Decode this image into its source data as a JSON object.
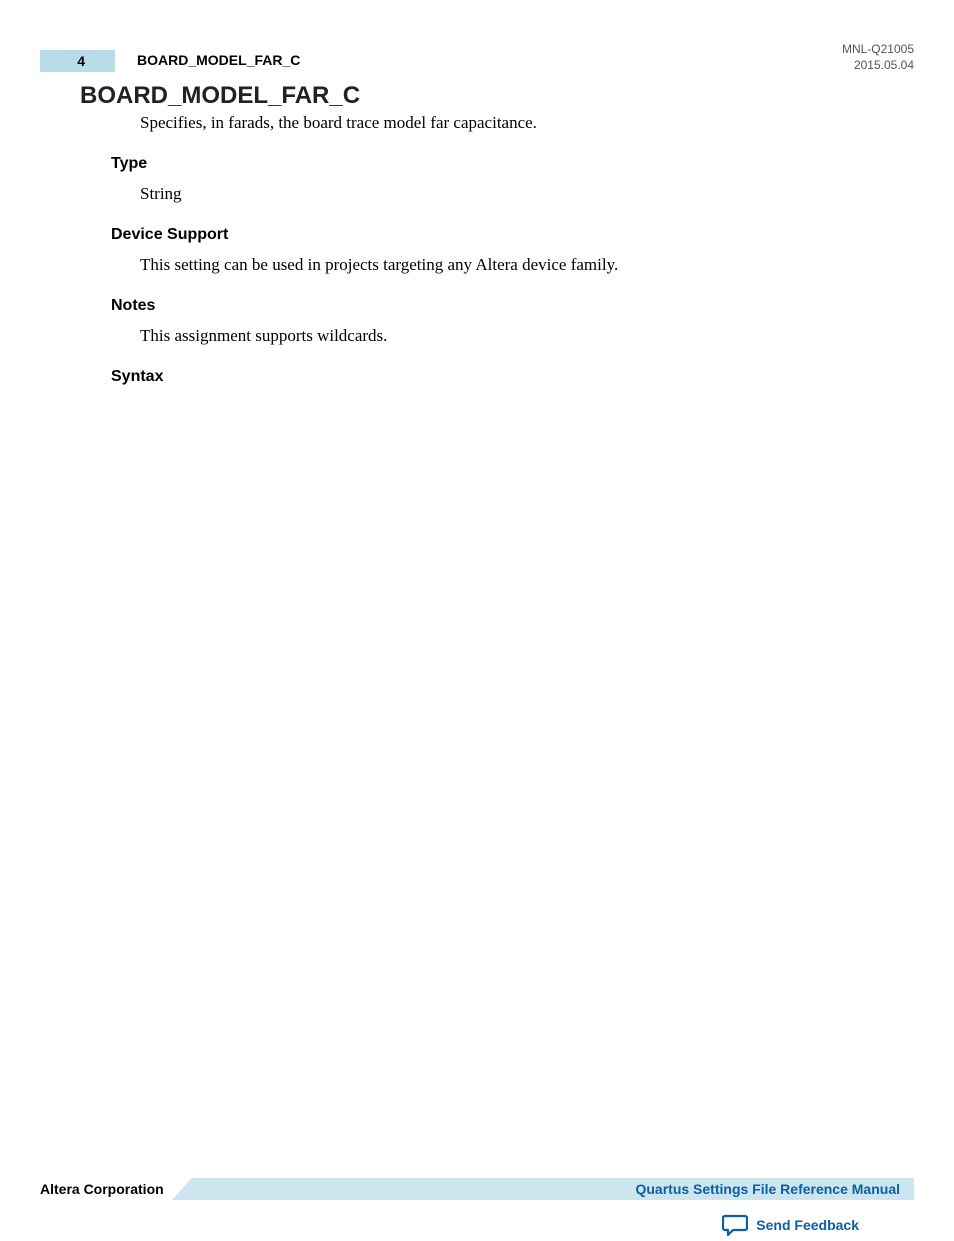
{
  "header": {
    "page_number": "4",
    "running_title": "BOARD_MODEL_FAR_C",
    "doc_id": "MNL-Q21005",
    "doc_date": "2015.05.04"
  },
  "title": "BOARD_MODEL_FAR_C",
  "description": "Specifies, in farads, the board trace model far capacitance.",
  "sections": {
    "type": {
      "heading": "Type",
      "body": "String"
    },
    "device_support": {
      "heading": "Device Support",
      "body": "This setting can be used in projects targeting any Altera device family."
    },
    "notes": {
      "heading": "Notes",
      "body": "This assignment supports wildcards."
    },
    "syntax": {
      "heading": "Syntax"
    }
  },
  "footer": {
    "company": "Altera Corporation",
    "manual": "Quartus Settings File Reference Manual",
    "feedback": "Send Feedback"
  }
}
